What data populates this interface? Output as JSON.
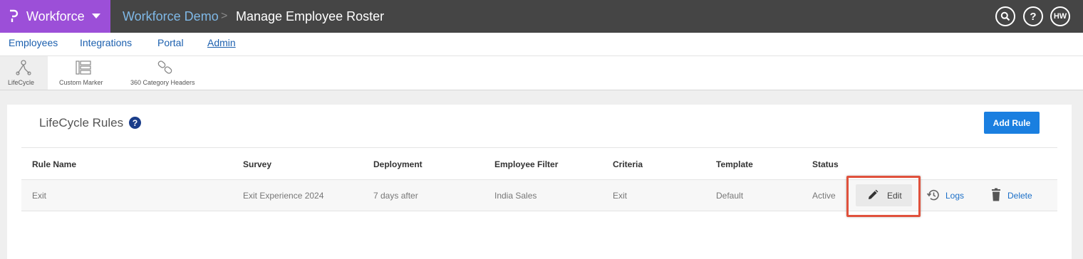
{
  "topbar": {
    "brand": "Workforce",
    "breadcrumb": [
      "Workforce Demo",
      "Manage Employee Roster"
    ],
    "separator": ">",
    "help_glyph": "?",
    "user_initials": "HW"
  },
  "nav": {
    "items": [
      "Employees",
      "Integrations",
      "Portal",
      "Admin"
    ],
    "active": "Admin"
  },
  "subnav": {
    "items": [
      {
        "label": "LifeCycle",
        "icon": "lifecycle-icon"
      },
      {
        "label": "Custom Marker",
        "icon": "custom-marker-icon"
      },
      {
        "label": "360 Category Headers",
        "icon": "link-chain-icon"
      }
    ],
    "active": "LifeCycle"
  },
  "card": {
    "title": "LifeCycle Rules",
    "help_glyph": "?",
    "add_button": "Add Rule"
  },
  "table": {
    "headers": [
      "Rule Name",
      "Survey",
      "Deployment",
      "Employee Filter",
      "Criteria",
      "Template",
      "Status"
    ],
    "rows": [
      {
        "rule_name": "Exit",
        "survey": "Exit Experience 2024",
        "deployment": "7 days after",
        "employee_filter": "India Sales",
        "criteria": "Exit",
        "template": "Default",
        "status": "Active",
        "actions": {
          "edit": "Edit",
          "logs": "Logs",
          "delete": "Delete"
        }
      }
    ]
  },
  "colors": {
    "topbar": "#454545",
    "brand": "#9c4fd8",
    "accent": "#1a7fe0",
    "link": "#1b5fae",
    "highlight": "#e0513c"
  }
}
